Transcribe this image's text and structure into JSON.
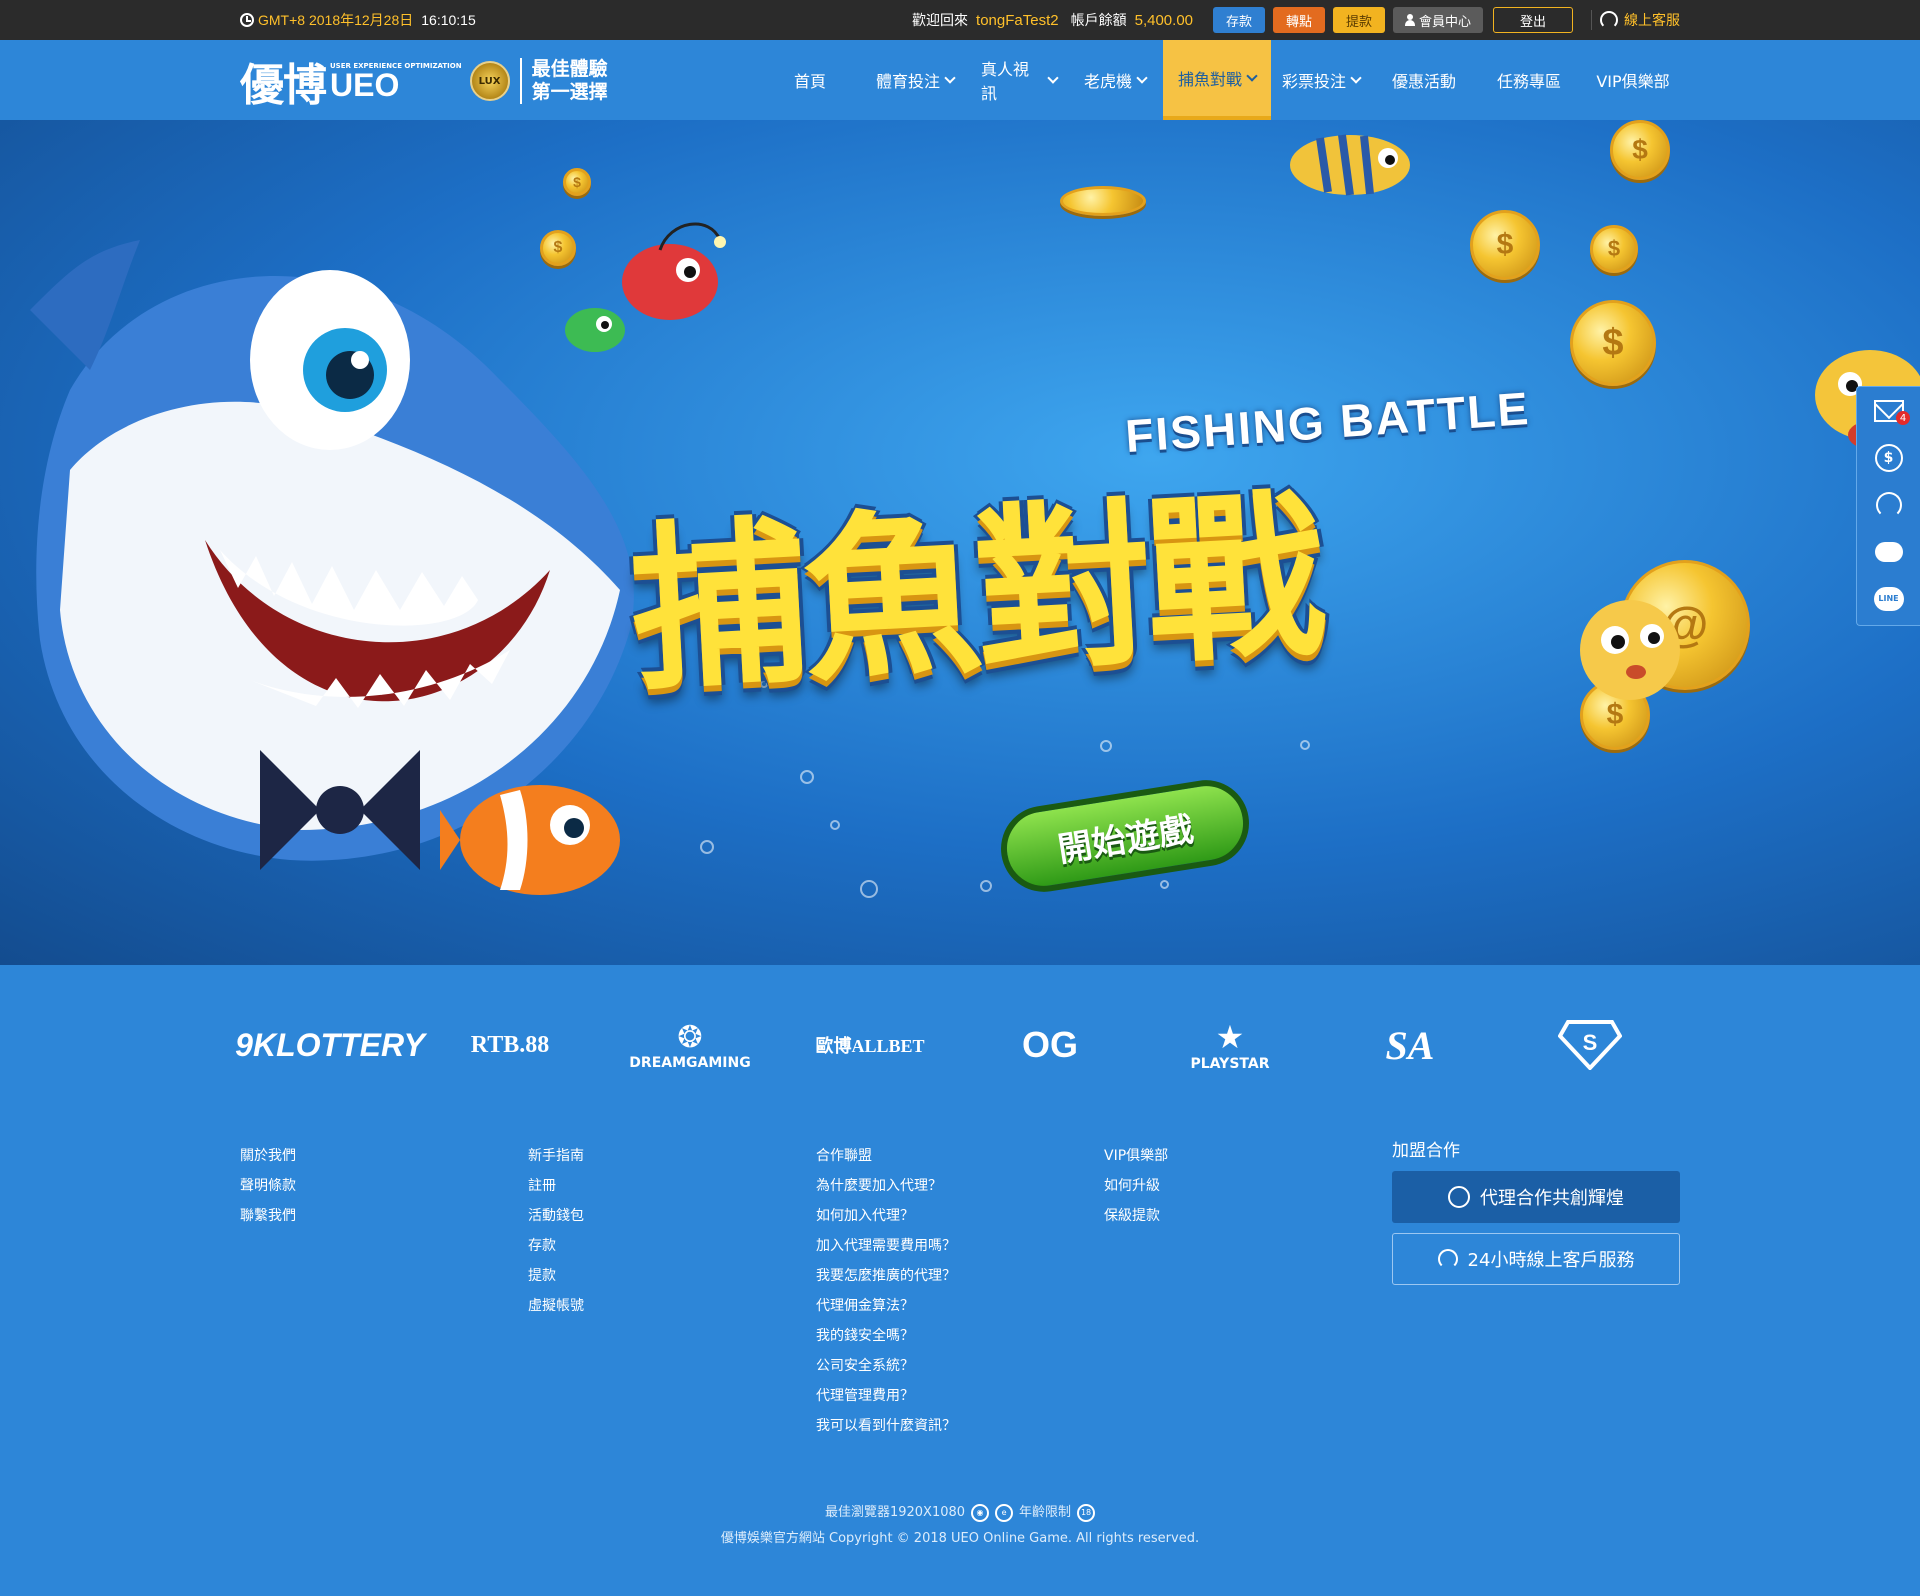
{
  "topbar": {
    "clock_label": "GMT+8 2018年12月28日",
    "clock_time": "16:10:15",
    "welcome": "歡迎回來",
    "username": "tongFaTest2",
    "balance_label": "帳戶餘額",
    "balance": "5,400.00",
    "btn_deposit": "存款",
    "btn_transfer": "轉點",
    "btn_withdraw": "提款",
    "btn_member": "會員中心",
    "btn_logout": "登出",
    "support": "線上客服"
  },
  "nav": {
    "logo_main": "優博",
    "logo_tiny": "USER EXPERIENCE OPTIMIZATION",
    "logo_ueo": "UEO",
    "logo_badge": "LUX",
    "slogan1": "最佳體驗",
    "slogan2": "第一選擇",
    "items": [
      {
        "label": "首頁"
      },
      {
        "label": "體育投注"
      },
      {
        "label": "真人視訊"
      },
      {
        "label": "老虎機"
      },
      {
        "label": "捕魚對戰"
      },
      {
        "label": "彩票投注"
      },
      {
        "label": "優惠活動"
      },
      {
        "label": "任務專區"
      },
      {
        "label": "VIP俱樂部"
      }
    ]
  },
  "banner": {
    "title_en": "FISHING BATTLE",
    "title_cn": "捕魚對戰",
    "start": "開始遊戲"
  },
  "sidefloat": {
    "mail_count": "4",
    "line": "LINE"
  },
  "partners": [
    "9KLOTTERY",
    "RTB.88",
    "DREAMGAMING",
    "歐博ALLBET",
    "OG",
    "PLAYSTAR",
    "SA",
    "S"
  ],
  "footer": {
    "col1": [
      "關於我們",
      "聲明條款",
      "聯繫我們"
    ],
    "col2": [
      "新手指南",
      "註冊",
      "活動錢包",
      "存款",
      "提款",
      "虛擬帳號"
    ],
    "col3": [
      "合作聯盟",
      "為什麼要加入代理？",
      "如何加入代理？",
      "加入代理需要費用嗎？",
      "我要怎麼推廣的代理？",
      "代理佣金算法？",
      "我的錢安全嗎？",
      "公司安全系統？",
      "代理管理費用？",
      "我可以看到什麼資訊？"
    ],
    "col4": [
      "VIP俱樂部",
      "如何升級",
      "保級提款"
    ],
    "join_title": "加盟合作",
    "join_btn1": "代理合作共創輝煌",
    "join_btn2": "24小時線上客戶服務",
    "browser": "最佳瀏覽器1920X1080",
    "age": "年齡限制",
    "age_badge": "18",
    "copyright": "優博娛樂官方網站 Copyright © 2018 UEO Online Game. All rights reserved."
  },
  "colors": {
    "topbar": "#2b2b2b",
    "primary": "#2d86d8",
    "accent": "#f6c244",
    "gold_text": "#ffc02a"
  }
}
